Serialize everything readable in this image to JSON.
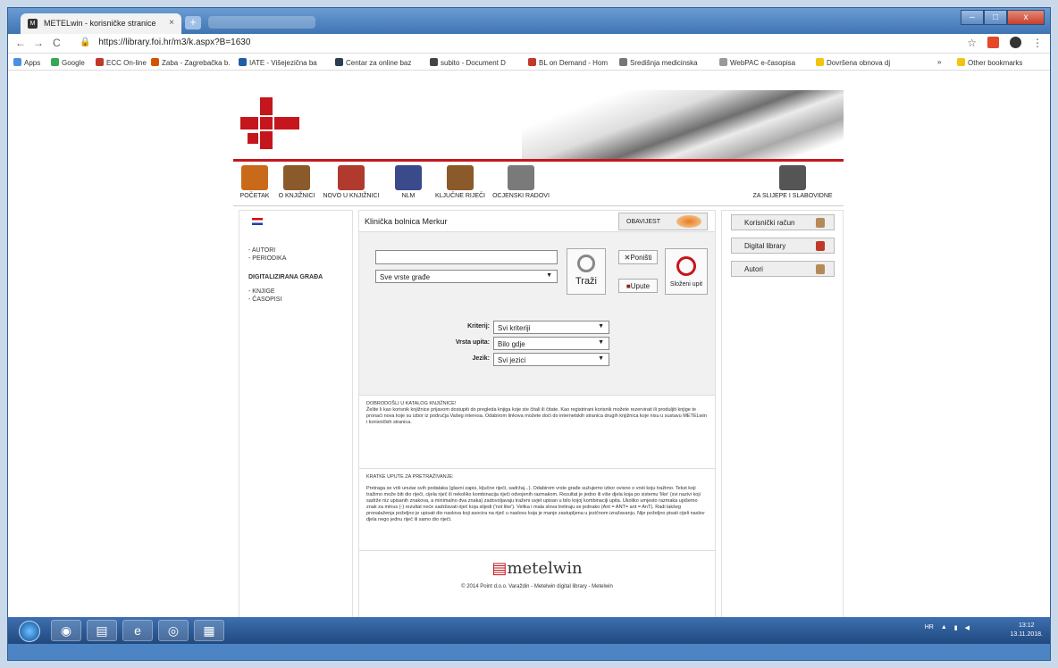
{
  "browser": {
    "tab_title": "METELwin - korisničke stranice",
    "tab_close": "×",
    "new_tab": "+",
    "url": "https://library.foi.hr/m3/k.aspx?B=1630",
    "nav_back": "←",
    "nav_forward": "→",
    "nav_reload": "C",
    "lock": "🔒",
    "star": "☆",
    "menu": "⋮",
    "win_min": "–",
    "win_max": "□",
    "win_close": "x"
  },
  "bookmarks": [
    {
      "label": "Apps",
      "color": "#4a90e2"
    },
    {
      "label": "Google",
      "color": "#34a853"
    },
    {
      "label": "ECC On-line",
      "color": "#c0392b"
    },
    {
      "label": "Zaba - Zagrebačka b.",
      "color": "#d35400"
    },
    {
      "label": "IATE - Višejezična ba",
      "color": "#1f5fa8"
    },
    {
      "label": "Centar za online baz",
      "color": "#2c3e50"
    },
    {
      "label": "subito - Document D",
      "color": "#444"
    },
    {
      "label": "BL on Demand - Hom",
      "color": "#c0392b"
    },
    {
      "label": "Središnja medicinska",
      "color": "#777"
    },
    {
      "label": "WebPAC e-časopisa",
      "color": "#999"
    },
    {
      "label": "Dovršena obnova dj",
      "color": "#f1c40f"
    },
    {
      "label": "»",
      "color": "#fff"
    },
    {
      "label": "Other bookmarks",
      "color": "#f1c40f"
    }
  ],
  "menu": [
    {
      "label": "POČETAK",
      "icon": "home-icon",
      "color": "#c86a1a"
    },
    {
      "label": "O KNJIŽNICI",
      "icon": "library-building-icon",
      "color": "#8a5a2a"
    },
    {
      "label": "NOVO U KNJIŽNICI",
      "icon": "new-books-icon",
      "color": "#b03a2e"
    },
    {
      "label": "NLM",
      "icon": "nlm-icon",
      "color": "#3b4a8a"
    },
    {
      "label": "KLJUČNE RIJEČI",
      "icon": "keywords-icon",
      "color": "#8a5a2a"
    },
    {
      "label": "OCJENSKI RADOVI",
      "icon": "graduation-cap-icon",
      "color": "#7a7a7a"
    },
    {
      "label": "ZA SLIJEPE I SLABOVIDNE",
      "icon": "braille-icon",
      "color": "#555"
    }
  ],
  "sidebar": {
    "links_top": [
      "- AUTORI",
      "- PERIODIKA"
    ],
    "section_title": "DIGITALIZIRANA GRAĐA",
    "links_bottom": [
      "- KNJIGE",
      "- ČASOPISI"
    ]
  },
  "main": {
    "library_name": "Klinička bolnica Merkur",
    "obavijesti": "OBAVIJEST",
    "search_value": "",
    "material_type": "Sve vrste građe",
    "search_button": "Traži",
    "reset_button": "Poništi",
    "help_button": "Upute",
    "complex_button": "Složeni upit",
    "criteria_label": "Kriterij:",
    "criteria_value": "Svi kriteriji",
    "query_type_label": "Vrsta upita:",
    "query_type_value": "Bilo gdje",
    "language_label": "Jezik:",
    "language_value": "Svi jezici",
    "welcome_title": "DOBRODOŠLI U KATALOG KNJIŽNICE!",
    "welcome_text": "Želite li kao korisnik knjižnice prijavom dostupiti do pregleda knjiga koje ste čitali ili čitate. Kao registrirani korisnik možete rezervirati ili produljiti knjige te pronaći nova koje su izbor iz područja Vašeg interesa. Odabirom linkova možete doći do internetskih stranica drugih knjižnica koje nisu u sustavu METELwin i korisničkih stranica.",
    "tips_title": "KRATKE UPUTE ZA PRETRAŽIVANJE:",
    "tips_text": "Pretraga se vrši unutar svih podataka (glavni zapis, ključne riječi, sadržaj...). Odabirom vrste građe sužujemo izbor ovisno o vrsti koju tražimo. Tekst koji tražimo može biti dio riječi, cijela riječ ili nekoliko kombinacija riječi odvojenih razmakom. Rezultat je jedno ili više djela koja po sistemu 'like' (svi nazivi koji sadrže niz upisanih znakova, a minimalno dva znaka) zadovoljavaju traženi uvjet upisan u bilo kojoj kombinaciji upita. Ukoliko umjesto razmaka upišemo znak za minus (-) rezultat neće sadržavati riječ koja slijedi ('not like'). Velika i mala slova tretiraju se jednako (Ant = ANT= ant = AnT). Radi lakšeg pronalaženja poželjno je upisati dio naslova koji asocira na riječ u naslovu koja je manje zastupljena u jezičnom izražavanju. Nije poželjno pisati cijeli naslov djela nego jednu riječ ili samo dio riječi.",
    "footer_logo": "metelwin",
    "footer_copy": "© 2014 Point d.o.o. Varaždin - Metelwin digital library - Metelwin"
  },
  "right_panel": {
    "account": "Korisnički račun",
    "digital_library": "Digital library",
    "authors": "Autori"
  },
  "taskbar": {
    "lang": "HR",
    "time": "13:12",
    "date": "13.11.2018."
  }
}
